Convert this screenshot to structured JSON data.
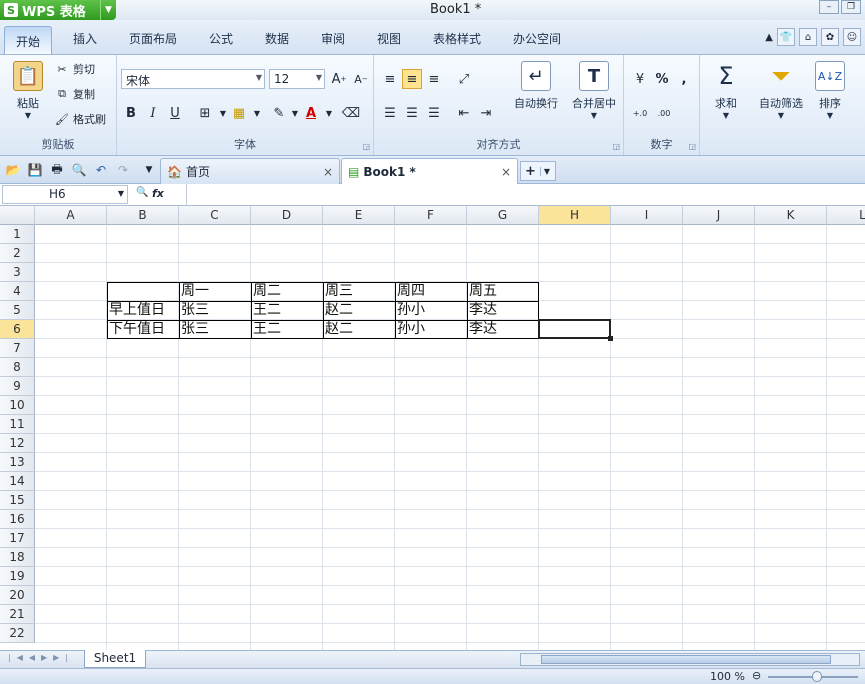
{
  "app": {
    "name": "WPS 表格",
    "logo": "S",
    "doc_title": "Book1 *"
  },
  "ribbon_tabs": [
    "开始",
    "插入",
    "页面布局",
    "公式",
    "数据",
    "审阅",
    "视图",
    "表格样式",
    "办公空间"
  ],
  "clipboard": {
    "paste": "粘贴",
    "cut": "剪切",
    "copy": "复制",
    "format_painter": "格式刷",
    "label": "剪贴板"
  },
  "font": {
    "name": "宋体",
    "size": "12",
    "label": "字体",
    "bold": "B",
    "italic": "I",
    "underline": "U"
  },
  "alignment": {
    "wrap": "自动换行",
    "merge": "合并居中",
    "label": "对齐方式"
  },
  "number": {
    "percent": "%",
    "comma": ",",
    "label": "数字"
  },
  "editing": {
    "sum": "求和",
    "filter": "自动筛选",
    "sort": "排序"
  },
  "doc_tabs": {
    "home": "首页",
    "book": "Book1 *"
  },
  "formula": {
    "cell_ref": "H6",
    "fx": "fx"
  },
  "columns": [
    "A",
    "B",
    "C",
    "D",
    "E",
    "F",
    "G",
    "H",
    "I",
    "J",
    "K",
    "L"
  ],
  "rows": [
    "1",
    "2",
    "3",
    "4",
    "5",
    "6",
    "7",
    "8",
    "9",
    "10",
    "11",
    "12",
    "13",
    "14",
    "15",
    "16",
    "17",
    "18",
    "19",
    "20",
    "21",
    "22"
  ],
  "table": {
    "header": [
      "周一",
      "周二",
      "周三",
      "周四",
      "周五"
    ],
    "row5": [
      "早上值日",
      "张三",
      "王二",
      "赵二",
      "孙小",
      "李达"
    ],
    "row6": [
      "下午值日",
      "张三",
      "王二",
      "赵二",
      "孙小",
      "李达"
    ]
  },
  "sheet": {
    "name": "Sheet1"
  },
  "status": {
    "zoom": "100 %"
  },
  "colors": {
    "accent_green": "#2f9a1f",
    "selected_header": "#f9e49a"
  }
}
